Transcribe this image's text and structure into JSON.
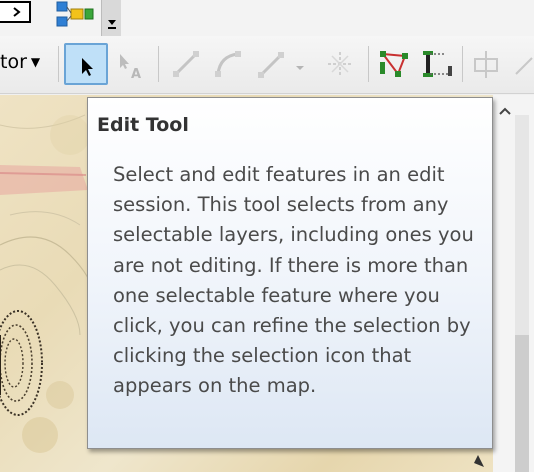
{
  "toolbar": {
    "editor_menu_label": "tor",
    "icons": [
      "command-line-icon",
      "model-builder-icon",
      "toolbar-overflow-icon"
    ],
    "tools": [
      "edit-tool",
      "edit-annotation-tool",
      "straight-segment-tool",
      "end-point-arc-tool",
      "trace-tool",
      "point-tool",
      "edit-vertices-tool",
      "reshape-feature-tool",
      "cut-polygons-tool",
      "split-tool"
    ]
  },
  "tooltip": {
    "title": "Edit Tool",
    "body": "Select and edit features in an edit session. This tool selects from any selectable layers, including ones you are not editing. If there is more than one selectable feature where you click, you can refine the selection by clicking the selection icon that appears on the map."
  },
  "colors": {
    "selected_tool_bg": "#bfe0f8",
    "selected_tool_border": "#6aa4d6",
    "map_background": "#ecdfbe",
    "tooltip_gradient_end": "#dde7f4"
  }
}
